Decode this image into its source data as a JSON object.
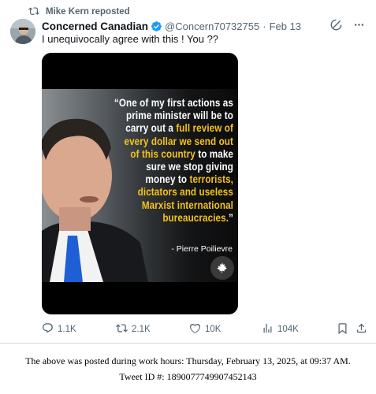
{
  "repost": {
    "label": "Mike Kern reposted"
  },
  "author": {
    "name": "Concerned Canadian",
    "handle": "@Concern70732755",
    "separator": "·",
    "date": "Feb 13"
  },
  "tweet": {
    "text": "I unequivocally agree with this ! You ??"
  },
  "media": {
    "quote_lines": [
      [
        {
          "t": "“One of my first actions as",
          "h": false
        }
      ],
      [
        {
          "t": "prime minister will be to",
          "h": false
        }
      ],
      [
        {
          "t": "carry out a ",
          "h": false
        },
        {
          "t": "full review of",
          "h": true
        }
      ],
      [
        {
          "t": "every dollar we send out",
          "h": true
        }
      ],
      [
        {
          "t": "of this country",
          "h": true
        },
        {
          "t": " to make",
          "h": false
        }
      ],
      [
        {
          "t": "sure we stop giving",
          "h": false
        }
      ],
      [
        {
          "t": "money to ",
          "h": false
        },
        {
          "t": "terrorists,",
          "h": true
        }
      ],
      [
        {
          "t": "dictators and useless",
          "h": true
        }
      ],
      [
        {
          "t": "Marxist international",
          "h": true
        }
      ],
      [
        {
          "t": "bureaucracies.",
          "h": true
        },
        {
          "t": "”",
          "h": false
        }
      ]
    ],
    "attribution": "- Pierre Poilievre",
    "highlight_color": "#f4c21c"
  },
  "actions": {
    "replies": "1.1K",
    "reposts": "2.1K",
    "likes": "10K",
    "views": "104K"
  },
  "footer": {
    "line1": "The above was posted during work hours: Thursday, February 13, 2025, at 09:37 AM.",
    "line2": "Tweet ID #: 1890077749907452143"
  },
  "colors": {
    "verified": "#1d9bf0",
    "muted": "#536471"
  },
  "icons": [
    "repost-icon",
    "verified-badge-icon",
    "grok-icon",
    "more-icon",
    "reply-icon",
    "repost-icon",
    "like-icon",
    "views-icon",
    "bookmark-icon",
    "share-icon"
  ]
}
